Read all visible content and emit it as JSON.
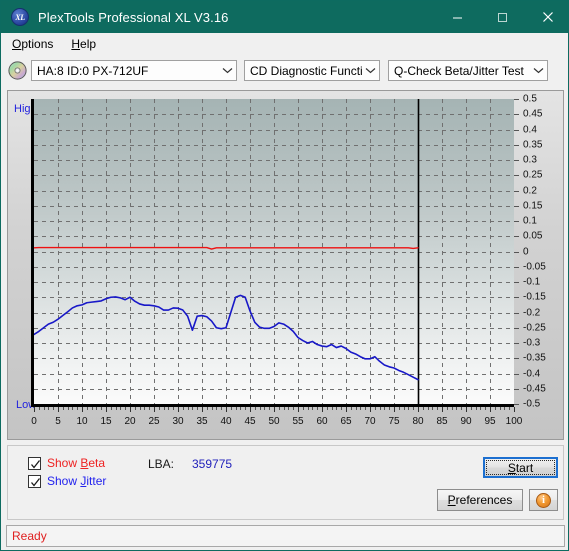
{
  "window": {
    "title": "PlexTools Professional XL V3.16",
    "icon": "xl-app-icon",
    "icon_text": "XL",
    "minimize": "–",
    "maximize": "□",
    "close": "✕",
    "titlebar_color": "#0e6b5f"
  },
  "menu": {
    "items": [
      {
        "label": "Options",
        "accel": "O"
      },
      {
        "label": "Help",
        "accel": "H"
      }
    ]
  },
  "toolbar": {
    "drive_icon": "cd-disc-icon",
    "drive_select": {
      "value": "HA:8 ID:0  PX-712UF",
      "options": [
        "HA:8 ID:0  PX-712UF"
      ]
    },
    "function_select": {
      "value": "CD Diagnostic Functions",
      "options": [
        "CD Diagnostic Functions"
      ]
    },
    "test_select": {
      "value": "Q-Check Beta/Jitter Test",
      "options": [
        "Q-Check Beta/Jitter Test"
      ]
    }
  },
  "chart_data": {
    "type": "line",
    "title": "",
    "xlabel": "",
    "ylabel": "",
    "xlim": [
      0,
      100
    ],
    "ylim": [
      -0.5,
      0.5
    ],
    "grid": true,
    "legend": "none",
    "axis_left_top_label": "High",
    "axis_left_bottom_label": "Low",
    "x_ticks": [
      0,
      5,
      10,
      15,
      20,
      25,
      30,
      35,
      40,
      45,
      50,
      55,
      60,
      65,
      70,
      75,
      80,
      85,
      90,
      95,
      100
    ],
    "y_ticks": [
      0.5,
      0.45,
      0.4,
      0.35,
      0.3,
      0.25,
      0.2,
      0.15,
      0.1,
      0.05,
      0,
      -0.05,
      -0.1,
      -0.15,
      -0.2,
      -0.25,
      -0.3,
      -0.35,
      -0.4,
      -0.45,
      -0.5
    ],
    "data_end_marker_x": 80,
    "series": [
      {
        "name": "Beta",
        "color": "#ee1111",
        "x": [
          0,
          1,
          2,
          4,
          6,
          8,
          10,
          12,
          14,
          16,
          18,
          20,
          22,
          24,
          26,
          28,
          30,
          32,
          34,
          36,
          37,
          38,
          40,
          42,
          44,
          46,
          48,
          50,
          52,
          54,
          56,
          58,
          60,
          62,
          64,
          66,
          68,
          70,
          72,
          74,
          76,
          78,
          79,
          80
        ],
        "values": [
          0.012,
          0.013,
          0.013,
          0.013,
          0.013,
          0.013,
          0.013,
          0.013,
          0.013,
          0.013,
          0.013,
          0.013,
          0.013,
          0.013,
          0.013,
          0.013,
          0.013,
          0.013,
          0.013,
          0.013,
          0.008,
          0.012,
          0.012,
          0.012,
          0.012,
          0.012,
          0.012,
          0.012,
          0.012,
          0.012,
          0.012,
          0.012,
          0.012,
          0.012,
          0.012,
          0.012,
          0.012,
          0.012,
          0.012,
          0.012,
          0.012,
          0.012,
          0.01,
          0.012
        ]
      },
      {
        "name": "Jitter",
        "color": "#1818c8",
        "x": [
          0,
          1,
          2,
          3,
          4,
          5,
          6,
          7,
          8,
          9,
          10,
          11,
          12,
          13,
          14,
          15,
          16,
          17,
          18,
          19,
          20,
          21,
          22,
          23,
          24,
          25,
          26,
          27,
          28,
          29,
          30,
          31,
          32,
          33,
          34,
          35,
          36,
          37,
          38,
          39,
          40,
          41,
          42,
          43,
          44,
          45,
          46,
          47,
          48,
          49,
          50,
          51,
          52,
          53,
          54,
          55,
          56,
          57,
          58,
          59,
          60,
          61,
          62,
          63,
          64,
          65,
          66,
          67,
          68,
          69,
          70,
          71,
          72,
          73,
          74,
          75,
          76,
          77,
          78,
          79,
          80
        ],
        "values": [
          -0.272,
          -0.262,
          -0.25,
          -0.238,
          -0.232,
          -0.222,
          -0.21,
          -0.198,
          -0.185,
          -0.178,
          -0.175,
          -0.168,
          -0.166,
          -0.164,
          -0.162,
          -0.155,
          -0.15,
          -0.149,
          -0.152,
          -0.158,
          -0.15,
          -0.163,
          -0.172,
          -0.176,
          -0.176,
          -0.178,
          -0.182,
          -0.192,
          -0.192,
          -0.185,
          -0.186,
          -0.192,
          -0.212,
          -0.258,
          -0.212,
          -0.21,
          -0.214,
          -0.228,
          -0.25,
          -0.253,
          -0.25,
          -0.2,
          -0.15,
          -0.144,
          -0.15,
          -0.195,
          -0.232,
          -0.248,
          -0.252,
          -0.252,
          -0.246,
          -0.234,
          -0.238,
          -0.248,
          -0.262,
          -0.282,
          -0.292,
          -0.3,
          -0.295,
          -0.305,
          -0.31,
          -0.312,
          -0.305,
          -0.315,
          -0.31,
          -0.318,
          -0.33,
          -0.336,
          -0.345,
          -0.352,
          -0.352,
          -0.345,
          -0.36,
          -0.372,
          -0.378,
          -0.382,
          -0.39,
          -0.396,
          -0.404,
          -0.412,
          -0.42
        ]
      }
    ]
  },
  "options": {
    "show_beta": {
      "label": "Show Beta",
      "accel": "B",
      "checked": true,
      "color": "#ee2222"
    },
    "show_jitter": {
      "label": "Show Jitter",
      "accel": "J",
      "checked": true,
      "color": "#2222ee"
    },
    "lba_label": "LBA:",
    "lba_value": "359775",
    "start_button": {
      "label": "Start",
      "accel": "S",
      "focused": true
    },
    "preferences_button": {
      "label": "Preferences",
      "accel": "P"
    },
    "info_button": {
      "label": "i",
      "icon": "info-icon"
    }
  },
  "status": {
    "text": "Ready",
    "color": "#e02020"
  }
}
